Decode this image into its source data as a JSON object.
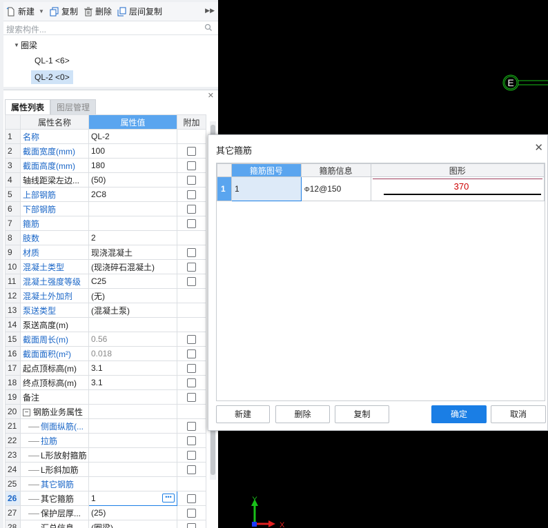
{
  "toolbar": {
    "new_label": "新建",
    "copy_label": "复制",
    "delete_label": "删除",
    "layer_copy_label": "层间复制"
  },
  "search": {
    "placeholder": "搜索构件..."
  },
  "tree": {
    "root": "圈梁",
    "items": [
      "QL-1 <6>",
      "QL-2 <0>"
    ],
    "selected_index": 1
  },
  "panel": {
    "tabs": [
      "属性列表",
      "图层管理"
    ],
    "headers": {
      "name": "属性名称",
      "value": "属性值",
      "extra": "附加"
    },
    "rows": [
      {
        "no": "1",
        "name": "名称",
        "value": "QL-2",
        "style": "blue",
        "cb": false
      },
      {
        "no": "2",
        "name": "截面宽度(mm)",
        "value": "100",
        "style": "blue",
        "cb": true
      },
      {
        "no": "3",
        "name": "截面高度(mm)",
        "value": "180",
        "style": "blue",
        "cb": true
      },
      {
        "no": "4",
        "name": "轴线距梁左边...",
        "value": "(50)",
        "style": "black",
        "cb": true
      },
      {
        "no": "5",
        "name": "上部钢筋",
        "value": "2C8",
        "style": "blue",
        "cb": true
      },
      {
        "no": "6",
        "name": "下部钢筋",
        "value": "",
        "style": "blue",
        "cb": true
      },
      {
        "no": "7",
        "name": "箍筋",
        "value": "",
        "style": "blue",
        "cb": true
      },
      {
        "no": "8",
        "name": "肢数",
        "value": "2",
        "style": "blue",
        "cb": false
      },
      {
        "no": "9",
        "name": "材质",
        "value": "现浇混凝土",
        "style": "blue",
        "cb": true
      },
      {
        "no": "10",
        "name": "混凝土类型",
        "value": "(现浇碎石混凝土)",
        "style": "blue",
        "cb": true
      },
      {
        "no": "11",
        "name": "混凝土强度等级",
        "value": "C25",
        "style": "blue",
        "cb": true
      },
      {
        "no": "12",
        "name": "混凝土外加剂",
        "value": "(无)",
        "style": "blue",
        "cb": false
      },
      {
        "no": "13",
        "name": "泵送类型",
        "value": "(混凝土泵)",
        "style": "blue",
        "cb": false
      },
      {
        "no": "14",
        "name": "泵送高度(m)",
        "value": "",
        "style": "black",
        "cb": false
      },
      {
        "no": "15",
        "name": "截面周长(m)",
        "value": "0.56",
        "style": "blue",
        "valgray": true,
        "cb": true
      },
      {
        "no": "16",
        "name": "截面面积(m²)",
        "value": "0.018",
        "style": "blue",
        "valgray": true,
        "cb": true
      },
      {
        "no": "17",
        "name": "起点顶标高(m)",
        "value": "3.1",
        "style": "black",
        "cb": true
      },
      {
        "no": "18",
        "name": "终点顶标高(m)",
        "value": "3.1",
        "style": "black",
        "cb": true
      },
      {
        "no": "19",
        "name": "备注",
        "value": "",
        "style": "black",
        "cb": true
      },
      {
        "no": "20",
        "name": "钢筋业务属性",
        "value": "",
        "style": "black",
        "group": true,
        "cb": false
      },
      {
        "no": "21",
        "name": "侧面纵筋(...",
        "value": "",
        "style": "blue",
        "child": true,
        "cb": true
      },
      {
        "no": "22",
        "name": "拉筋",
        "value": "",
        "style": "blue",
        "child": true,
        "cb": true
      },
      {
        "no": "23",
        "name": "L形放射箍筋",
        "value": "",
        "style": "black",
        "child": true,
        "cb": true
      },
      {
        "no": "24",
        "name": "L形斜加筋",
        "value": "",
        "style": "black",
        "child": true,
        "cb": true
      },
      {
        "no": "25",
        "name": "其它钢筋",
        "value": "",
        "style": "blue",
        "child": true,
        "cb": false
      },
      {
        "no": "26",
        "name": "其它箍筋",
        "value": "1",
        "style": "black",
        "child": true,
        "cb": true,
        "active": true
      },
      {
        "no": "27",
        "name": "保护层厚...",
        "value": "(25)",
        "style": "black",
        "child": true,
        "cb": true
      },
      {
        "no": "28",
        "name": "汇总信息",
        "value": "(圈梁)",
        "style": "black",
        "child": true,
        "cb": true
      }
    ]
  },
  "dialog": {
    "title": "其它箍筋",
    "headers": [
      "箍筋图号",
      "箍筋信息",
      "图形"
    ],
    "row": {
      "no": "1",
      "shape_no": "1",
      "info": "12@150",
      "bar_symbol": "Φ",
      "dimension": "370"
    },
    "buttons": {
      "new": "新建",
      "delete": "删除",
      "copy": "复制",
      "ok": "确定",
      "cancel": "取消"
    }
  },
  "canvas": {
    "marker_label": "E",
    "axis_y_label": "Y",
    "axis_x_label": "X"
  }
}
